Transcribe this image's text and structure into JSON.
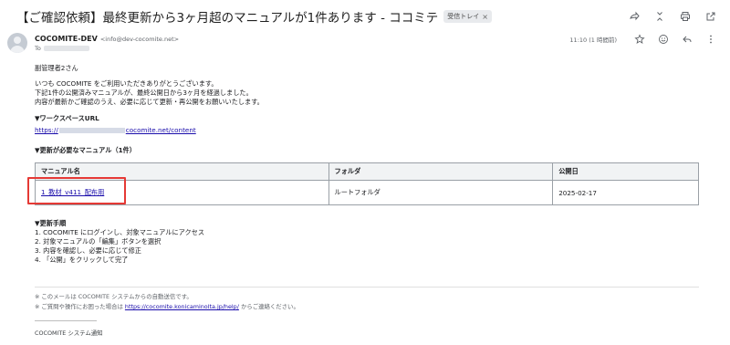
{
  "email": {
    "subject": "【ご確認依頼】最終更新から3ヶ月超のマニュアルが1件あります - ココミテ",
    "label": "受信トレイ",
    "label_close": "×",
    "sender_name": "COCOMITE-DEV",
    "sender_email": "<info@dev-cocomite.net>",
    "to_prefix": "To",
    "timestamp": "11:10 (1 時間前)"
  },
  "top_actions": [
    "forward-icon",
    "expand-icon",
    "print-icon",
    "open-in-new-icon"
  ],
  "sender_actions": [
    "star-icon",
    "emoji-icon",
    "reply-icon",
    "more-icon"
  ],
  "body": {
    "greeting": "副管理者2さん",
    "intro_line1": "いつも COCOMITE をご利用いただきありがとうございます。",
    "intro_line2": "下記1件の公開済みマニュアルが、最終公開日から3ヶ月を経過しました。",
    "intro_line3": "内容が最新かご確認のうえ、必要に応じて更新・再公開をお願いいたします。",
    "workspace_heading": "▼ワークスペースURL",
    "workspace_url_prefix": "https://",
    "workspace_url_suffix": "cocomite.net/content",
    "manuals_heading": "▼更新が必要なマニュアル（1件）",
    "steps_heading": "▼更新手順",
    "steps": [
      "1. COCOMITE にログインし、対象マニュアルにアクセス",
      "2. 対象マニュアルの「編集」ボタンを選択",
      "3. 内容を確認し、必要に応じて修正",
      "4. 「公開」をクリックして完了"
    ]
  },
  "table": {
    "headers": [
      "マニュアル名",
      "フォルダ",
      "公開日"
    ],
    "rows": [
      {
        "name": "1_教材_v411_配布用",
        "folder": "ルートフォルダ",
        "date": "2025-02-17"
      }
    ]
  },
  "footer": {
    "note1": "※ このメールは COCOMITE システムからの自動送信です。",
    "note2_prefix": "※ ご質問や操作にお困った場合は ",
    "note2_link": "https://cocomite.konicaminolta.jp/help/",
    "note2_suffix": " からご連絡ください。",
    "signature": "COCOMITE システム通知"
  },
  "colors": {
    "link": "#1a0dab",
    "highlight": "#e53935"
  }
}
